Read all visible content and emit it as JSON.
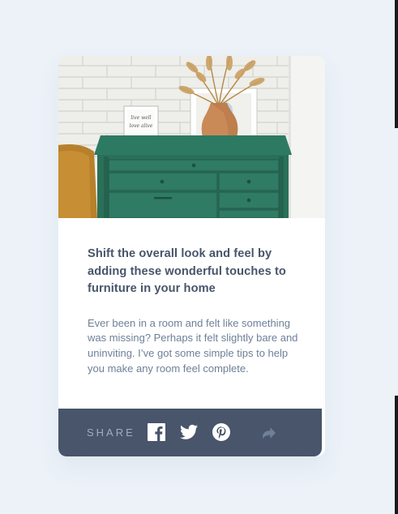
{
  "card": {
    "title": "Shift the overall look and feel by adding these wonderful touches to furniture in your home",
    "description": "Ever been in a room and felt like something was missing? Perhaps it felt slightly bare and uninviting. I’ve got some simple tips to help you make any room feel complete.",
    "image_alt": "drawers",
    "frame_text": "live well love alive"
  },
  "share": {
    "label": "SHARE",
    "icons": [
      "facebook-icon",
      "twitter-icon",
      "pinterest-icon",
      "share-icon"
    ]
  },
  "colors": {
    "page_background": "#ecf2f8",
    "card_background": "#ffffff",
    "title": "#48556a",
    "body_text": "#6e8098",
    "share_bar": "#48556a",
    "share_label": "#9eafc2"
  }
}
